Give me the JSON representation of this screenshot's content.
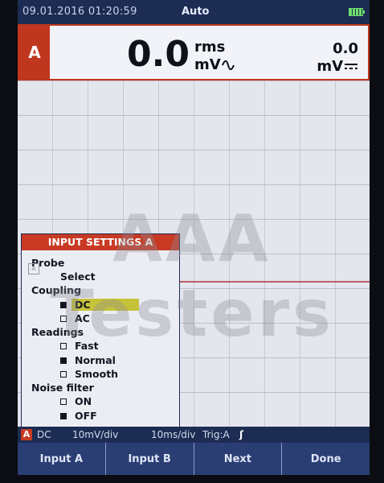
{
  "status": {
    "datetime": "09.01.2016 01:20:59",
    "mode": "Auto"
  },
  "readout": {
    "channel": "A",
    "main_value": "0.0",
    "unit_line1": "rms",
    "unit_line2": "mV",
    "secondary_value": "0.0",
    "secondary_unit": "mV"
  },
  "menu": {
    "title": "INPUT SETTINGS A",
    "probe_label": "Probe",
    "probe_select": "Select",
    "coupling_label": "Coupling",
    "coupling_dc": "DC",
    "coupling_ac": "AC",
    "readings_label": "Readings",
    "readings_fast": "Fast",
    "readings_normal": "Normal",
    "readings_smooth": "Smooth",
    "noise_label": "Noise filter",
    "noise_on": "ON",
    "noise_off": "OFF"
  },
  "bottom_status": {
    "channel": "A",
    "coupling": "DC",
    "volts_div": "10mV/div",
    "time_div": "10ms/div",
    "trigger": "Trig:A"
  },
  "softkeys": [
    "Input A",
    "Input B",
    "Next",
    "Done"
  ],
  "watermark": "AAA Testers",
  "colors": {
    "accent_red": "#c83a24",
    "status_bar": "#1c2c52",
    "selection": "#c6c23a",
    "softkey": "#2a3e74"
  }
}
